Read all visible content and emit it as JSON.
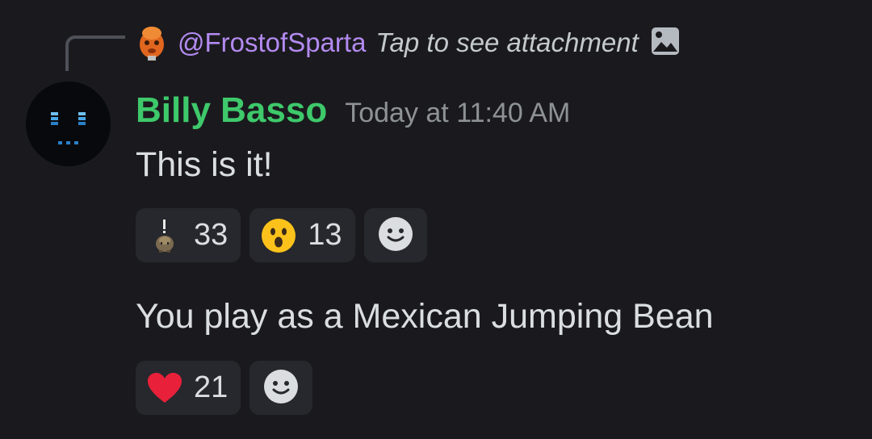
{
  "reply": {
    "author": "@FrostofSparta",
    "snippet": "Tap to see attachment",
    "attachment_icon": "image-icon",
    "author_color": "#b38af0"
  },
  "message": {
    "author": "Billy Basso",
    "author_color": "#3ec96b",
    "timestamp": "Today at 11:40 AM",
    "avatar_icon": "robot-face-avatar"
  },
  "messages": [
    {
      "text": "This is it!",
      "reactions": [
        {
          "emoji": "custom-figure-emoji",
          "count": "33"
        },
        {
          "emoji": "astonished-face-emoji",
          "count": "13"
        }
      ],
      "add_reaction_icon": "add-reaction-smiley-icon"
    },
    {
      "text": "You play as a Mexican Jumping Bean",
      "reactions": [
        {
          "emoji": "red-heart-emoji",
          "count": "21"
        }
      ],
      "add_reaction_icon": "add-reaction-smiley-icon"
    }
  ],
  "colors": {
    "background": "#1a1a1e",
    "reaction_bg": "#27282d",
    "text": "#dbdee1",
    "timestamp": "#8e9297"
  }
}
